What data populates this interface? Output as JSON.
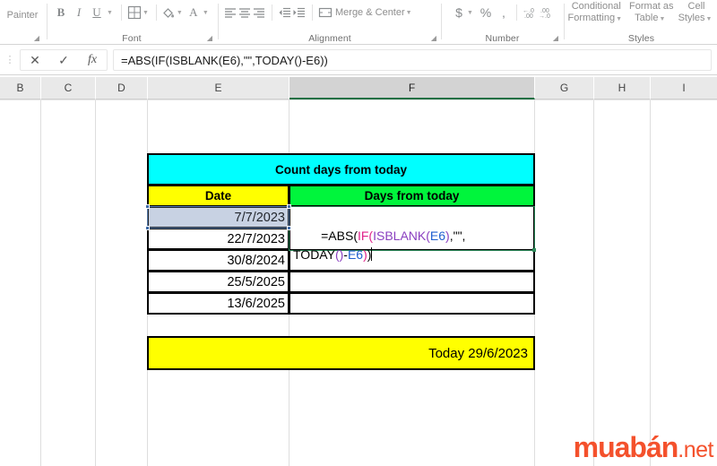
{
  "ribbon": {
    "groups": [
      {
        "name": "font",
        "label": "Font"
      },
      {
        "name": "alignment",
        "label": "Alignment"
      },
      {
        "name": "number",
        "label": "Number"
      },
      {
        "name": "styles",
        "label": "Styles"
      }
    ],
    "clipboard": {
      "painter_label": "Painter"
    },
    "font": {
      "bold": "B",
      "italic": "I",
      "underline": "U",
      "borders_icon": "borders-icon",
      "fill_icon": "fill-color-icon",
      "font_color": "A"
    },
    "alignment": {
      "align_left_icon": "align-left-icon",
      "align_center_icon": "align-center-icon",
      "align_right_icon": "align-right-icon",
      "decrease_indent_icon": "decrease-indent-icon",
      "increase_indent_icon": "increase-indent-icon",
      "merge_label": "Merge & Center"
    },
    "number": {
      "currency": "$",
      "percent": "%",
      "comma": ",",
      "decrease_decimal": "decrease-decimal-icon",
      "increase_decimal": "increase-decimal-icon"
    },
    "styles": {
      "conditional_formatting": [
        "Conditional",
        "Formatting"
      ],
      "format_as_table": [
        "Format as",
        "Table"
      ],
      "cell_styles": [
        "Cell",
        "Styles"
      ]
    }
  },
  "formula_bar": {
    "cancel_icon": "✕",
    "enter_icon": "✓",
    "fx_icon": "fx",
    "value": "=ABS(IF(ISBLANK(E6),\"\",TODAY()-E6))"
  },
  "columns": [
    {
      "label": "B",
      "selected": false
    },
    {
      "label": "C",
      "selected": false
    },
    {
      "label": "D",
      "selected": false
    },
    {
      "label": "E",
      "selected": false
    },
    {
      "label": "F",
      "selected": true
    },
    {
      "label": "G",
      "selected": false
    },
    {
      "label": "H",
      "selected": false
    },
    {
      "label": "I",
      "selected": false
    }
  ],
  "sheet": {
    "title": "Count days from today",
    "header_date": "Date",
    "header_days": "Days from today",
    "rows": [
      {
        "date": "7/7/2023",
        "days": ""
      },
      {
        "date": "22/7/2023",
        "days": ""
      },
      {
        "date": "30/8/2024",
        "days": ""
      },
      {
        "date": "25/5/2025",
        "days": ""
      },
      {
        "date": "13/6/2025",
        "days": ""
      }
    ],
    "today_label": "Today 29/6/2023",
    "editing_cell": {
      "address": "F6",
      "tokens": [
        {
          "text": "=ABS(",
          "color": "black"
        },
        {
          "text": "IF(",
          "color": "red"
        },
        {
          "text": "ISBLANK(",
          "color": "purple"
        },
        {
          "text": "E6",
          "color": "blue"
        },
        {
          "text": ")",
          "color": "purple"
        },
        {
          "text": ",\"\",",
          "color": "black"
        },
        {
          "text": "TODAY",
          "color": "black"
        },
        {
          "text": "()",
          "color": "purple"
        },
        {
          "text": "-",
          "color": "black"
        },
        {
          "text": "E6",
          "color": "blue"
        },
        {
          "text": ")",
          "color": "red"
        },
        {
          "text": ")",
          "color": "black"
        }
      ],
      "line1": "=ABS(IF(ISBLANK(E6),\"\",",
      "line2": "TODAY()-E6))"
    },
    "reference_cell": "E6"
  },
  "colors": {
    "title_fill": "#00ffff",
    "date_header_fill": "#ffff00",
    "days_header_fill": "#00f53c",
    "today_fill": "#ffff00",
    "selection_green": "#2f8a5b",
    "reference_blue": "#3f6ba8",
    "watermark": "#f4512c"
  },
  "watermark": {
    "brand": "muabán",
    "tld": ".net"
  }
}
